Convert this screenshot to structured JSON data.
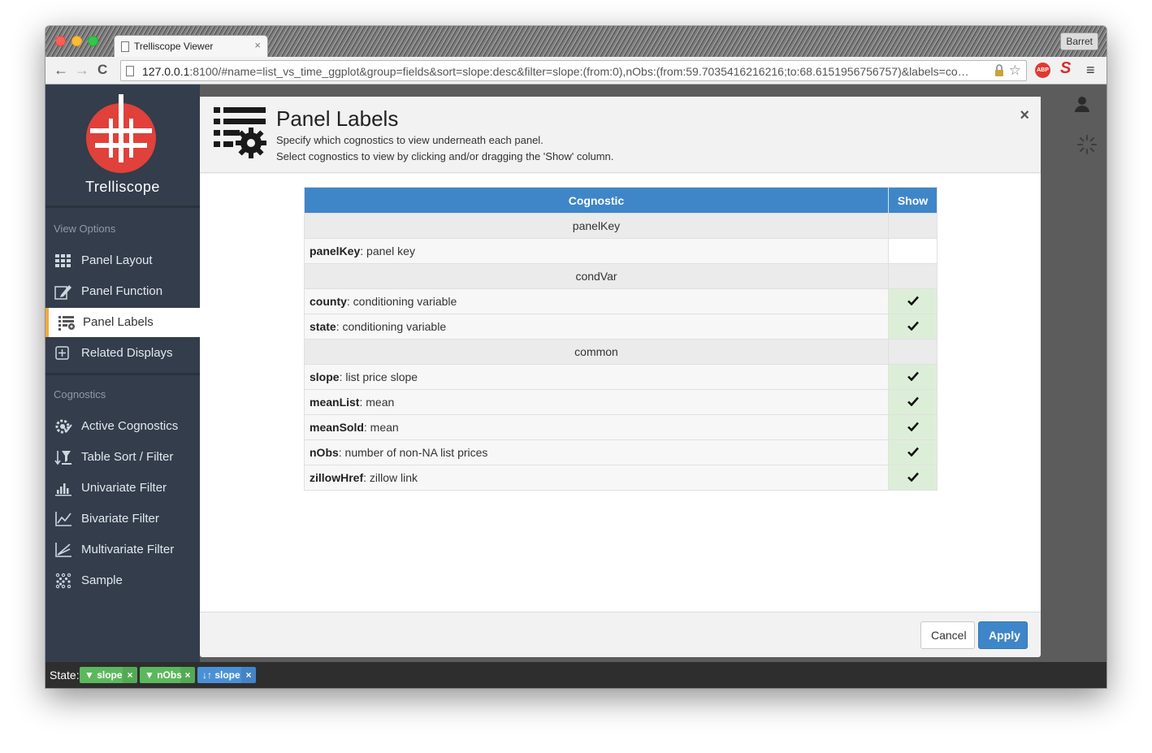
{
  "browser": {
    "tab_title": "Trelliscope Viewer",
    "tab_close": "×",
    "user_label": "Barret",
    "url_host": "127.0.0.1",
    "url_rest": ":8100/#name=list_vs_time_ggplot&group=fields&sort=slope:desc&filter=slope:(from:0),nObs:(from:59.7035416216216;to:68.6151956756757)&labels=co…",
    "back": "←",
    "forward": "→",
    "reload": "C",
    "star": "☆",
    "abp": "ABP",
    "s_ext": "S",
    "menu": "≡"
  },
  "sidebar": {
    "logo_text": "Trelliscope",
    "view_options_label": "View Options",
    "view_items": [
      {
        "label": "Panel Layout",
        "icon": "grid-icon"
      },
      {
        "label": "Panel Function",
        "icon": "edit-icon"
      },
      {
        "label": "Panel Labels",
        "icon": "labels-icon",
        "active": true
      },
      {
        "label": "Related Displays",
        "icon": "plus-square-icon"
      }
    ],
    "cognostics_label": "Cognostics",
    "cog_items": [
      {
        "label": "Active Cognostics",
        "icon": "cogs-check-icon"
      },
      {
        "label": "Table Sort / Filter",
        "icon": "sort-filter-icon"
      },
      {
        "label": "Univariate Filter",
        "icon": "bar-chart-icon"
      },
      {
        "label": "Bivariate Filter",
        "icon": "line-chart-icon"
      },
      {
        "label": "Multivariate Filter",
        "icon": "multi-chart-icon"
      },
      {
        "label": "Sample",
        "icon": "dots-grid-icon"
      }
    ]
  },
  "modal": {
    "title": "Panel Labels",
    "subtitle1": "Specify which cognostics to view underneath each panel.",
    "subtitle2": "Select cognostics to view by clicking and/or dragging the 'Show' column.",
    "close": "×",
    "table": {
      "header_cognostic": "Cognostic",
      "header_show": "Show",
      "groups": [
        {
          "name": "panelKey",
          "rows": [
            {
              "key": "panelKey",
              "desc": ": panel key",
              "show": false
            }
          ]
        },
        {
          "name": "condVar",
          "rows": [
            {
              "key": "county",
              "desc": ": conditioning variable",
              "show": true
            },
            {
              "key": "state",
              "desc": ": conditioning variable",
              "show": true
            }
          ]
        },
        {
          "name": "common",
          "rows": [
            {
              "key": "slope",
              "desc": ": list price slope",
              "show": true
            },
            {
              "key": "meanList",
              "desc": ": mean",
              "show": true
            },
            {
              "key": "meanSold",
              "desc": ": mean",
              "show": true
            },
            {
              "key": "nObs",
              "desc": ": number of non-NA list prices",
              "show": true
            },
            {
              "key": "zillowHref",
              "desc": ": zillow link",
              "show": true
            }
          ]
        }
      ]
    },
    "cancel_label": "Cancel",
    "apply_label": "Apply"
  },
  "state_bar": {
    "label": "State:",
    "chips": [
      {
        "text": "▼ slope",
        "kind": "filter",
        "color": "#5cb85c"
      },
      {
        "text": "▼ nObs",
        "kind": "filter",
        "color": "#5cb85c"
      },
      {
        "text": "↓↑ slope",
        "kind": "sort",
        "color": "#4a90d6"
      }
    ],
    "chip_close": "×"
  },
  "colors": {
    "sidebar_bg": "#333d4c",
    "accent_active": "#f2a93b",
    "table_header": "#3e86c8",
    "show_on": "#ddeed8",
    "logo_red": "#e0413a"
  }
}
